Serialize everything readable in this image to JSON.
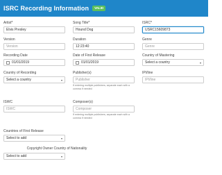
{
  "header": {
    "title": "ISRC Recording Information",
    "badge": "VALID"
  },
  "fields": {
    "artist": {
      "label": "Artist",
      "req": "*",
      "value": "Elvis Presley"
    },
    "song_title": {
      "label": "Song Title",
      "req": "*",
      "value": "Hound Dog"
    },
    "isrc": {
      "label": "ISRC",
      "req": "*",
      "value": "USRC15609873"
    },
    "version": {
      "label": "Version",
      "placeholder": "Version"
    },
    "duration": {
      "label": "Duration",
      "value": "12:23:40"
    },
    "genre": {
      "label": "Genre",
      "placeholder": "Genre"
    },
    "recording_date": {
      "label": "Recording Date",
      "value": "01/01/2019"
    },
    "first_release_date": {
      "label": "Date of First Release",
      "value": "01/01/2019"
    },
    "country_mastering": {
      "label": "Country of Mastering",
      "value": "Select a country"
    },
    "country_recording": {
      "label": "Country of Recording",
      "value": "Select a country"
    },
    "publishers": {
      "label": "Publisher(s)",
      "placeholder": "Publisher",
      "help": "If entering multiple publishers, separate each with a comma if needed"
    },
    "ipi": {
      "label": "IPI/line",
      "placeholder": "IPI/line"
    },
    "iswc": {
      "label": "ISWC",
      "placeholder": "ISWC"
    },
    "composers": {
      "label": "Composer(s)",
      "placeholder": "Composer",
      "help": "If entering multiple publishers, separate each with a comma if needed"
    },
    "countries_first_release": {
      "label": "Countries of First Release",
      "value": "Select to add"
    },
    "copyright_owner_country": {
      "label": "Copyright Owner Country of Nationality",
      "value": "Select to add"
    }
  },
  "colors": {
    "header": "#1f86c9",
    "badge": "#5bbf5b",
    "focus": "#1f86c9"
  }
}
